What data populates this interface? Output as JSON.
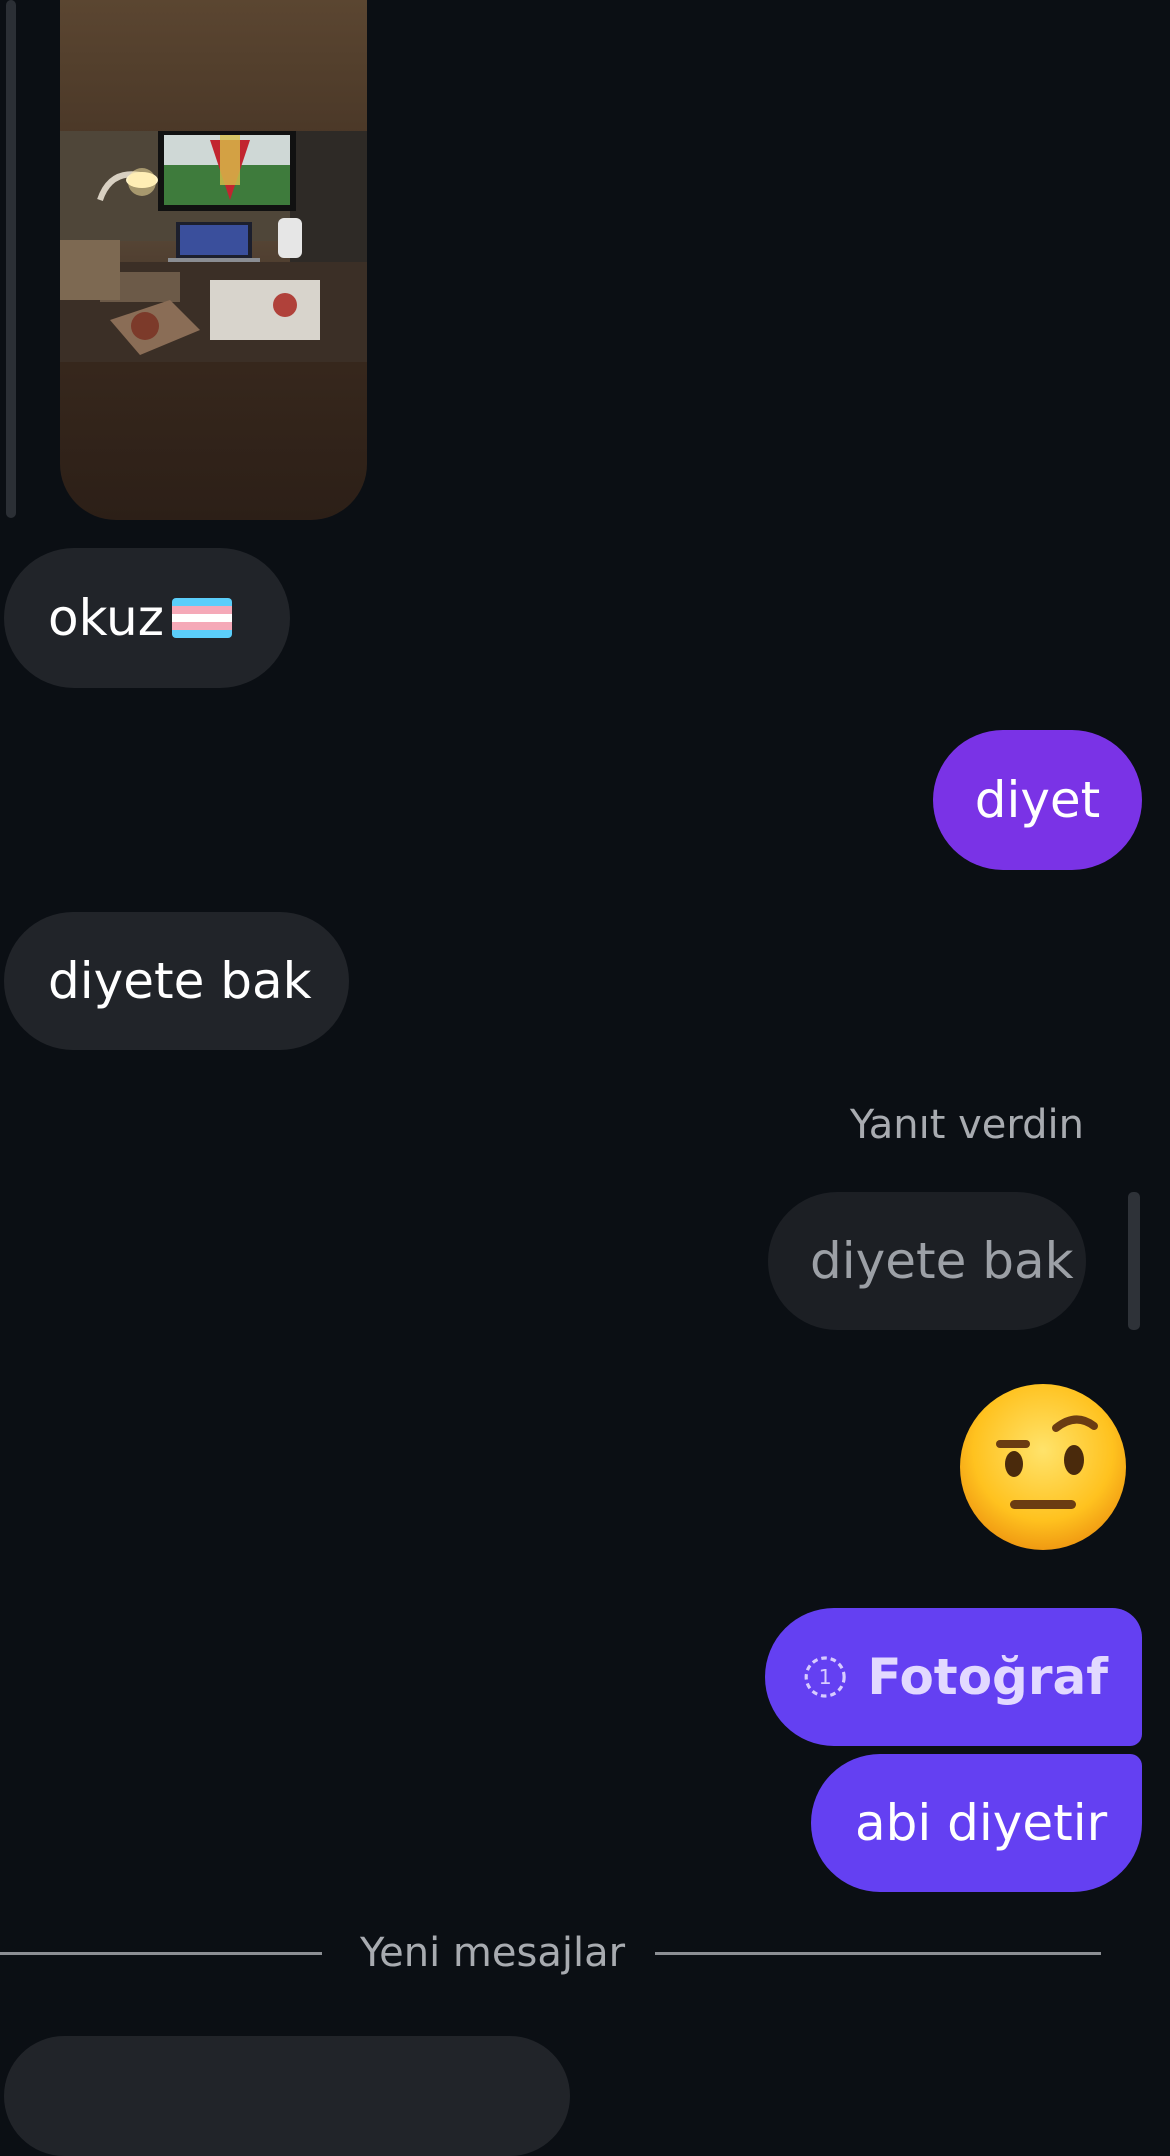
{
  "messages": {
    "incoming_1": "okuz",
    "outgoing_1": "diyet",
    "incoming_2": "diyete bak",
    "reply_label": "Yanıt verdin",
    "reply_quote": "diyete bak",
    "outgoing_photo": "Fotoğraf",
    "outgoing_2": "abi diyetir",
    "new_messages": "Yeni mesajlar"
  },
  "icons": {
    "flag": "transgender-flag-icon",
    "emoji": "face-with-raised-eyebrow-icon",
    "photo": "view-once-photo-icon"
  },
  "colors": {
    "background": "#0b0f14",
    "incoming_bubble": "#212429",
    "outgoing_purple": "#7a33e6",
    "outgoing_indigo": "#6440f2"
  }
}
